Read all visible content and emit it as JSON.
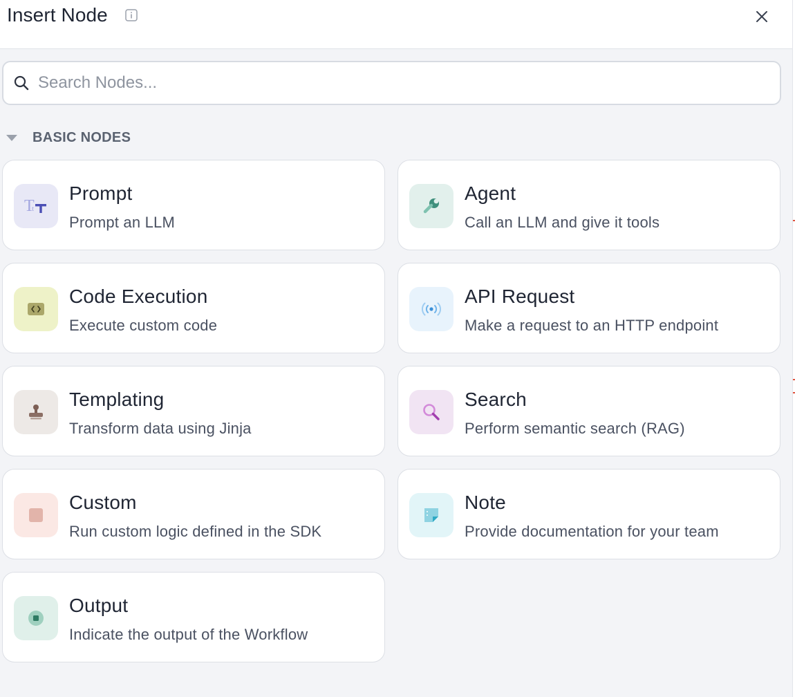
{
  "header": {
    "title": "Insert Node"
  },
  "search": {
    "placeholder": "Search Nodes..."
  },
  "section": {
    "label": "BASIC NODES"
  },
  "nodes": [
    {
      "title": "Prompt",
      "desc": "Prompt an LLM",
      "icon": "text-format-icon",
      "icon_bg": "#e8e8f6"
    },
    {
      "title": "Agent",
      "desc": "Call an LLM and give it tools",
      "icon": "wrench-icon",
      "icon_bg": "#e2f0ec"
    },
    {
      "title": "Code Execution",
      "desc": "Execute custom code",
      "icon": "code-icon",
      "icon_bg": "#eef2c8"
    },
    {
      "title": "API Request",
      "desc": "Make a request to an HTTP endpoint",
      "icon": "broadcast-icon",
      "icon_bg": "#e8f3fc"
    },
    {
      "title": "Templating",
      "desc": "Transform data using Jinja",
      "icon": "stamp-icon",
      "icon_bg": "#ede9e6"
    },
    {
      "title": "Search",
      "desc": "Perform semantic search (RAG)",
      "icon": "magnifier-icon",
      "icon_bg": "#f1e4f3"
    },
    {
      "title": "Custom",
      "desc": "Run custom logic defined in the SDK",
      "icon": "square-icon",
      "icon_bg": "#fbe8e4"
    },
    {
      "title": "Note",
      "desc": "Provide documentation for your team",
      "icon": "sticky-note-icon",
      "icon_bg": "#e2f5f8"
    },
    {
      "title": "Output",
      "desc": "Indicate the output of the Workflow",
      "icon": "output-icon",
      "icon_bg": "#e0f0ea"
    }
  ]
}
